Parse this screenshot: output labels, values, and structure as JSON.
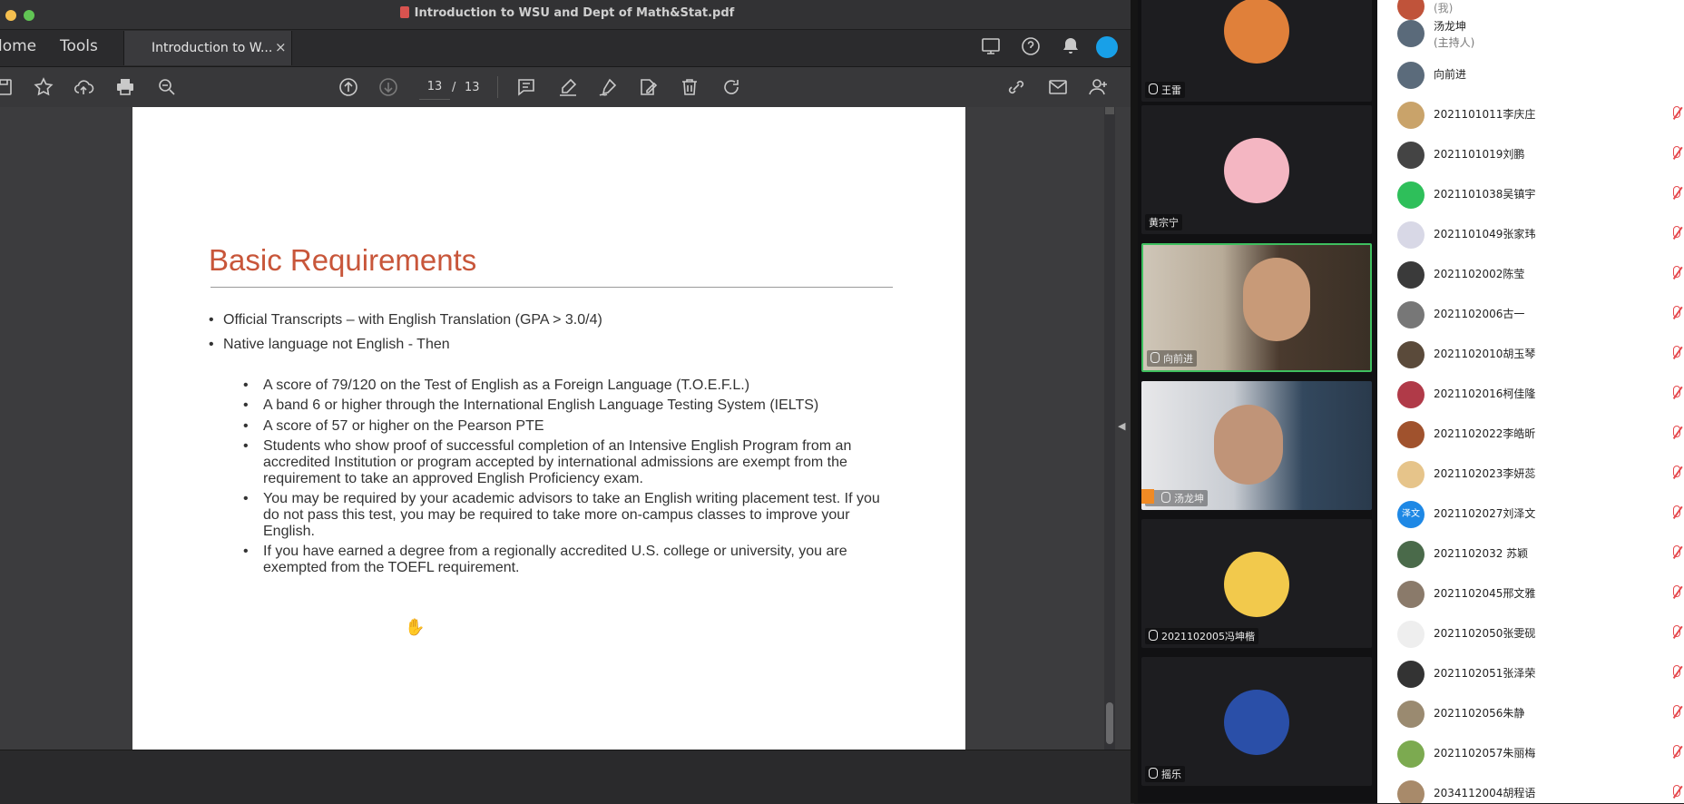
{
  "window": {
    "title": "Introduction to WSU and Dept of Math&Stat.pdf"
  },
  "tabs": {
    "home": "lome",
    "tools": "Tools",
    "document": "Introduction to W...",
    "close": "×"
  },
  "toolbar": {
    "page_current": "13",
    "page_separator": "/",
    "page_total": "13"
  },
  "page": {
    "title": "Basic Requirements",
    "bullets": [
      "Official Transcripts – with English Translation (GPA > 3.0/4)",
      "Native language not English - Then"
    ],
    "sub_bullets": [
      "A score of 79/120 on the Test of English as a Foreign Language (T.O.E.F.L.)",
      "A band 6 or higher through the International English Language Testing System (IELTS)",
      "A score of 57 or higher on the Pearson PTE",
      "Students who show proof of successful completion of an Intensive English Program from an accredited Institution or program accepted by international admissions are exempt from the requirement to take an approved English Proficiency exam.",
      "You may be required by your academic advisors to take an English writing placement test. If you do not pass this test, you may be required to take more on-campus classes to improve your English.",
      "If you have earned a degree from a regionally accredited U.S. college or university, you are exempted from the TOEFL requirement."
    ]
  },
  "video_tiles": [
    {
      "name": "王雷",
      "color": "#e0803a"
    },
    {
      "name": "黄宗宁",
      "color": "#f4b6c2"
    },
    {
      "name": "向前进",
      "color": "#6b5a44"
    },
    {
      "name": "汤龙坤",
      "color": "#33485e"
    },
    {
      "name": "2021102005冯坤楷",
      "color": "#f2c94c"
    },
    {
      "name": "摇乐",
      "color": "#2a4fa8"
    }
  ],
  "participants": {
    "top_partial": "(我)",
    "host": {
      "name": "汤龙坤",
      "role": "(主持人)"
    },
    "list": [
      {
        "name": "向前进",
        "color": "#5b6b7b"
      },
      {
        "name": "2021101011李庆庄",
        "color": "#c9a36a"
      },
      {
        "name": "2021101019刘鹏",
        "color": "#444444"
      },
      {
        "name": "2021101038吴镇宇",
        "color": "#2ebf5a"
      },
      {
        "name": "2021101049张家玮",
        "color": "#d8d8e6"
      },
      {
        "name": "2021102002陈莹",
        "color": "#3a3a3a"
      },
      {
        "name": "2021102006古一",
        "color": "#777777"
      },
      {
        "name": "2021102010胡玉琴",
        "color": "#5a4a3a"
      },
      {
        "name": "2021102016柯佳隆",
        "color": "#b03a48"
      },
      {
        "name": "2021102022李皓昕",
        "color": "#a0522d"
      },
      {
        "name": "2021102023李妍蕊",
        "color": "#e6c48a"
      },
      {
        "name": "2021102027刘泽文",
        "color": "#1e88e5",
        "initials": "泽文"
      },
      {
        "name": "2021102032 苏颖",
        "color": "#4a6a4a"
      },
      {
        "name": "2021102045邢文雅",
        "color": "#8a7a6a"
      },
      {
        "name": "2021102050张雯砚",
        "color": "#eeeeee"
      },
      {
        "name": "2021102051张泽荣",
        "color": "#333333"
      },
      {
        "name": "2021102056朱静",
        "color": "#9a8a70"
      },
      {
        "name": "2021102057朱丽梅",
        "color": "#7caa50"
      },
      {
        "name": "2034112004胡程语",
        "color": "#a88a6a"
      }
    ]
  }
}
